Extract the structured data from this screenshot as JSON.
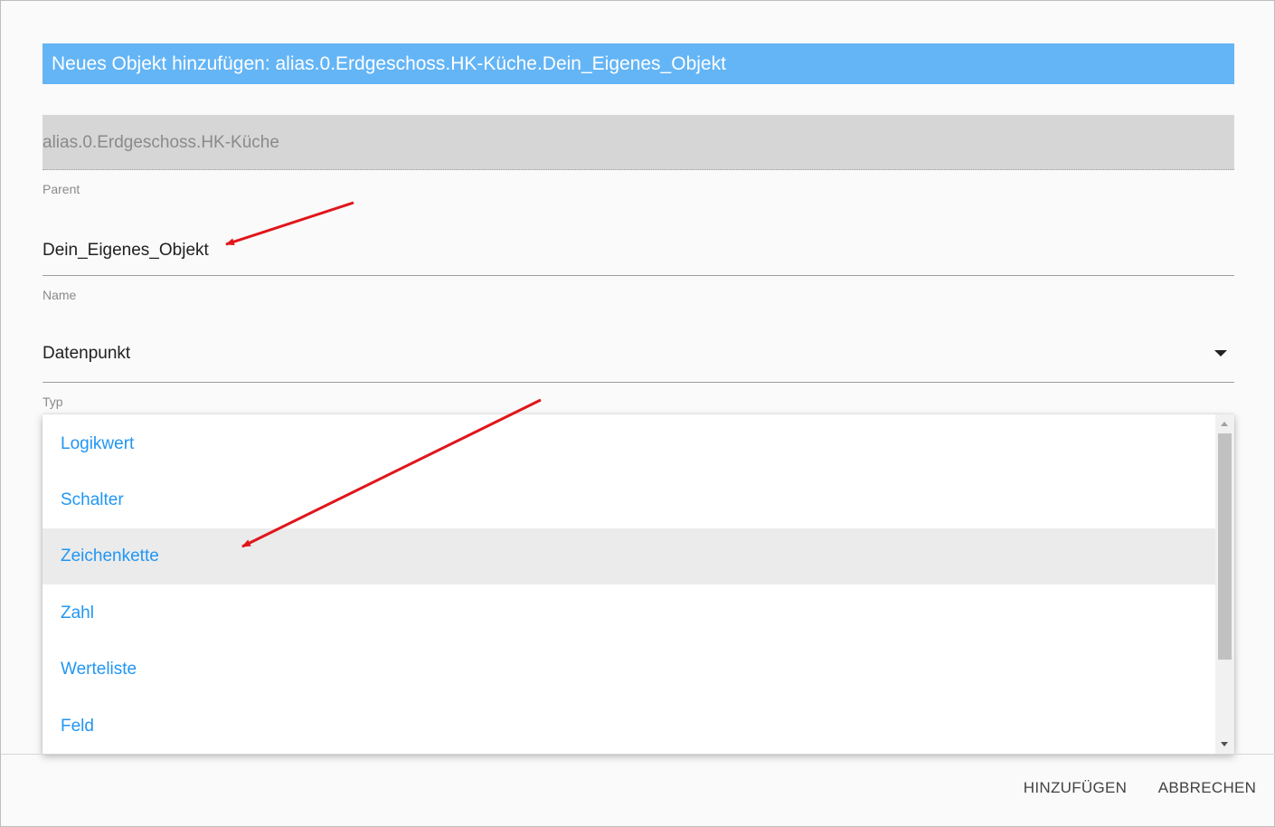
{
  "dialog": {
    "title": "Neues Objekt hinzufügen: alias.0.Erdgeschoss.HK-Küche.Dein_Eigenes_Objekt"
  },
  "parent": {
    "value": "alias.0.Erdgeschoss.HK-Küche",
    "label": "Parent"
  },
  "name": {
    "value": "Dein_Eigenes_Objekt",
    "label": "Name"
  },
  "type": {
    "selected": "Datenpunkt",
    "label": "Typ"
  },
  "dropdown": {
    "items": [
      {
        "label": "Logikwert"
      },
      {
        "label": "Schalter"
      },
      {
        "label": "Zeichenkette"
      },
      {
        "label": "Zahl"
      },
      {
        "label": "Werteliste"
      },
      {
        "label": "Feld"
      }
    ],
    "highlighted": "Zeichenkette"
  },
  "footer": {
    "add_label": "HINZUFÜGEN",
    "cancel_label": "ABBRECHEN"
  },
  "colors": {
    "title_bg": "#64b5f6",
    "menu_text": "#2196f3",
    "annotation_arrow": "#e0161b"
  }
}
